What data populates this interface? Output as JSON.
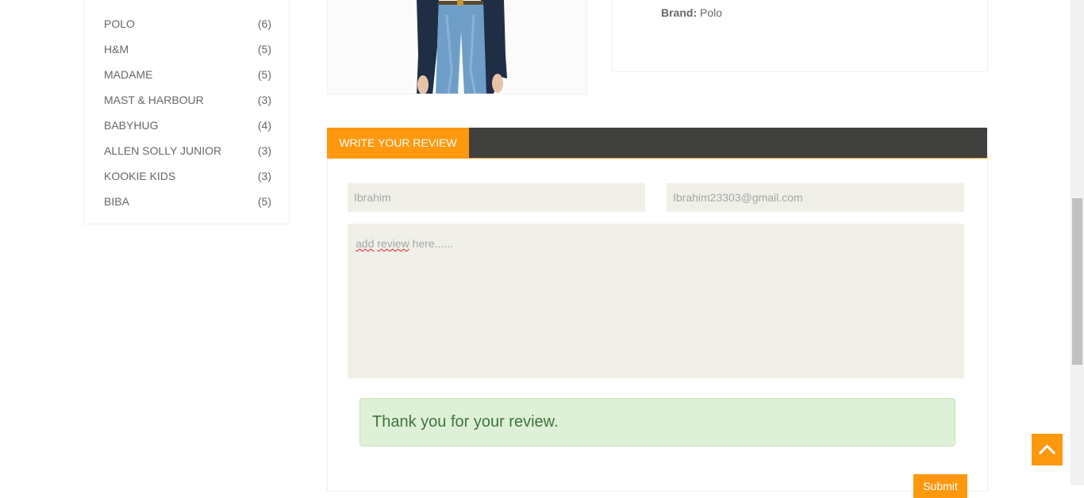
{
  "sidebar": {
    "brands": [
      {
        "name": "POLO",
        "count": "(6)"
      },
      {
        "name": "H&M",
        "count": "(5)"
      },
      {
        "name": "MADAME",
        "count": "(5)"
      },
      {
        "name": "MAST & HARBOUR",
        "count": "(3)"
      },
      {
        "name": "BABYHUG",
        "count": "(4)"
      },
      {
        "name": "ALLEN SOLLY JUNIOR",
        "count": "(3)"
      },
      {
        "name": "KOOKIE KIDS",
        "count": "(3)"
      },
      {
        "name": "BIBA",
        "count": "(5)"
      }
    ]
  },
  "product": {
    "brand_label": "Brand:",
    "brand_value": "Polo"
  },
  "review": {
    "tab_label": "WRITE YOUR REVIEW",
    "name_value": "Ibrahim",
    "email_value": "Ibrahim23303@gmail.com",
    "textarea_word1": "add",
    "textarea_word2": "review",
    "textarea_rest": " here......",
    "success_message": "Thank you for your review.",
    "submit_label": "Submit"
  },
  "colors": {
    "accent": "#FE980F",
    "header_dark": "#40403e",
    "field_bg": "#F0F0E9",
    "success_bg": "#dff0d8",
    "success_text": "#3c763d"
  },
  "icons": {
    "scroll_up": "chevron-up-icon"
  }
}
